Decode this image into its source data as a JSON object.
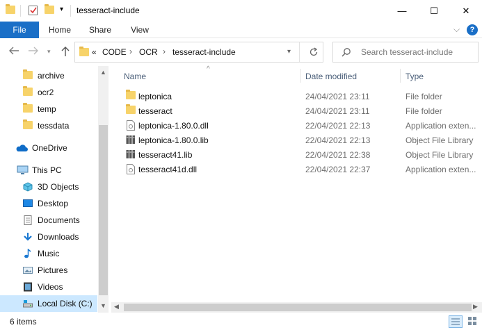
{
  "window": {
    "title": "tesseract-include",
    "minimize": "—",
    "maximize": "☐",
    "close": "✕"
  },
  "ribbon": {
    "tabs": [
      "File",
      "Home",
      "Share",
      "View"
    ],
    "expand_icon": "⌵",
    "help_icon": "?"
  },
  "address": {
    "overflow": "«",
    "crumbs": [
      "CODE",
      "OCR",
      "tesseract-include"
    ],
    "search_placeholder": "Search tesseract-include"
  },
  "nav": {
    "quick": [
      {
        "label": "archive",
        "icon": "folder-icon"
      },
      {
        "label": "ocr2",
        "icon": "folder-icon"
      },
      {
        "label": "temp",
        "icon": "folder-icon"
      },
      {
        "label": "tessdata",
        "icon": "folder-icon"
      }
    ],
    "onedrive": "OneDrive",
    "thispc": "This PC",
    "pc_items": [
      {
        "label": "3D Objects",
        "icon": "3d-objects-icon"
      },
      {
        "label": "Desktop",
        "icon": "desktop-icon"
      },
      {
        "label": "Documents",
        "icon": "documents-icon"
      },
      {
        "label": "Downloads",
        "icon": "downloads-icon"
      },
      {
        "label": "Music",
        "icon": "music-icon"
      },
      {
        "label": "Pictures",
        "icon": "pictures-icon"
      },
      {
        "label": "Videos",
        "icon": "videos-icon"
      },
      {
        "label": "Local Disk (C:)",
        "icon": "local-disk-icon"
      }
    ]
  },
  "columns": {
    "name": "Name",
    "date": "Date modified",
    "type": "Type"
  },
  "files": [
    {
      "name": "leptonica",
      "date": "24/04/2021 23:11",
      "type": "File folder",
      "icon": "folder-icon"
    },
    {
      "name": "tesseract",
      "date": "24/04/2021 23:11",
      "type": "File folder",
      "icon": "folder-icon"
    },
    {
      "name": "leptonica-1.80.0.dll",
      "date": "22/04/2021 22:13",
      "type": "Application exten...",
      "icon": "dll-icon"
    },
    {
      "name": "leptonica-1.80.0.lib",
      "date": "22/04/2021 22:13",
      "type": "Object File Library",
      "icon": "lib-icon"
    },
    {
      "name": "tesseract41.lib",
      "date": "22/04/2021 22:38",
      "type": "Object File Library",
      "icon": "lib-icon"
    },
    {
      "name": "tesseract41d.dll",
      "date": "22/04/2021 22:37",
      "type": "Application exten...",
      "icon": "dll-icon"
    }
  ],
  "status": {
    "count": "6 items"
  }
}
